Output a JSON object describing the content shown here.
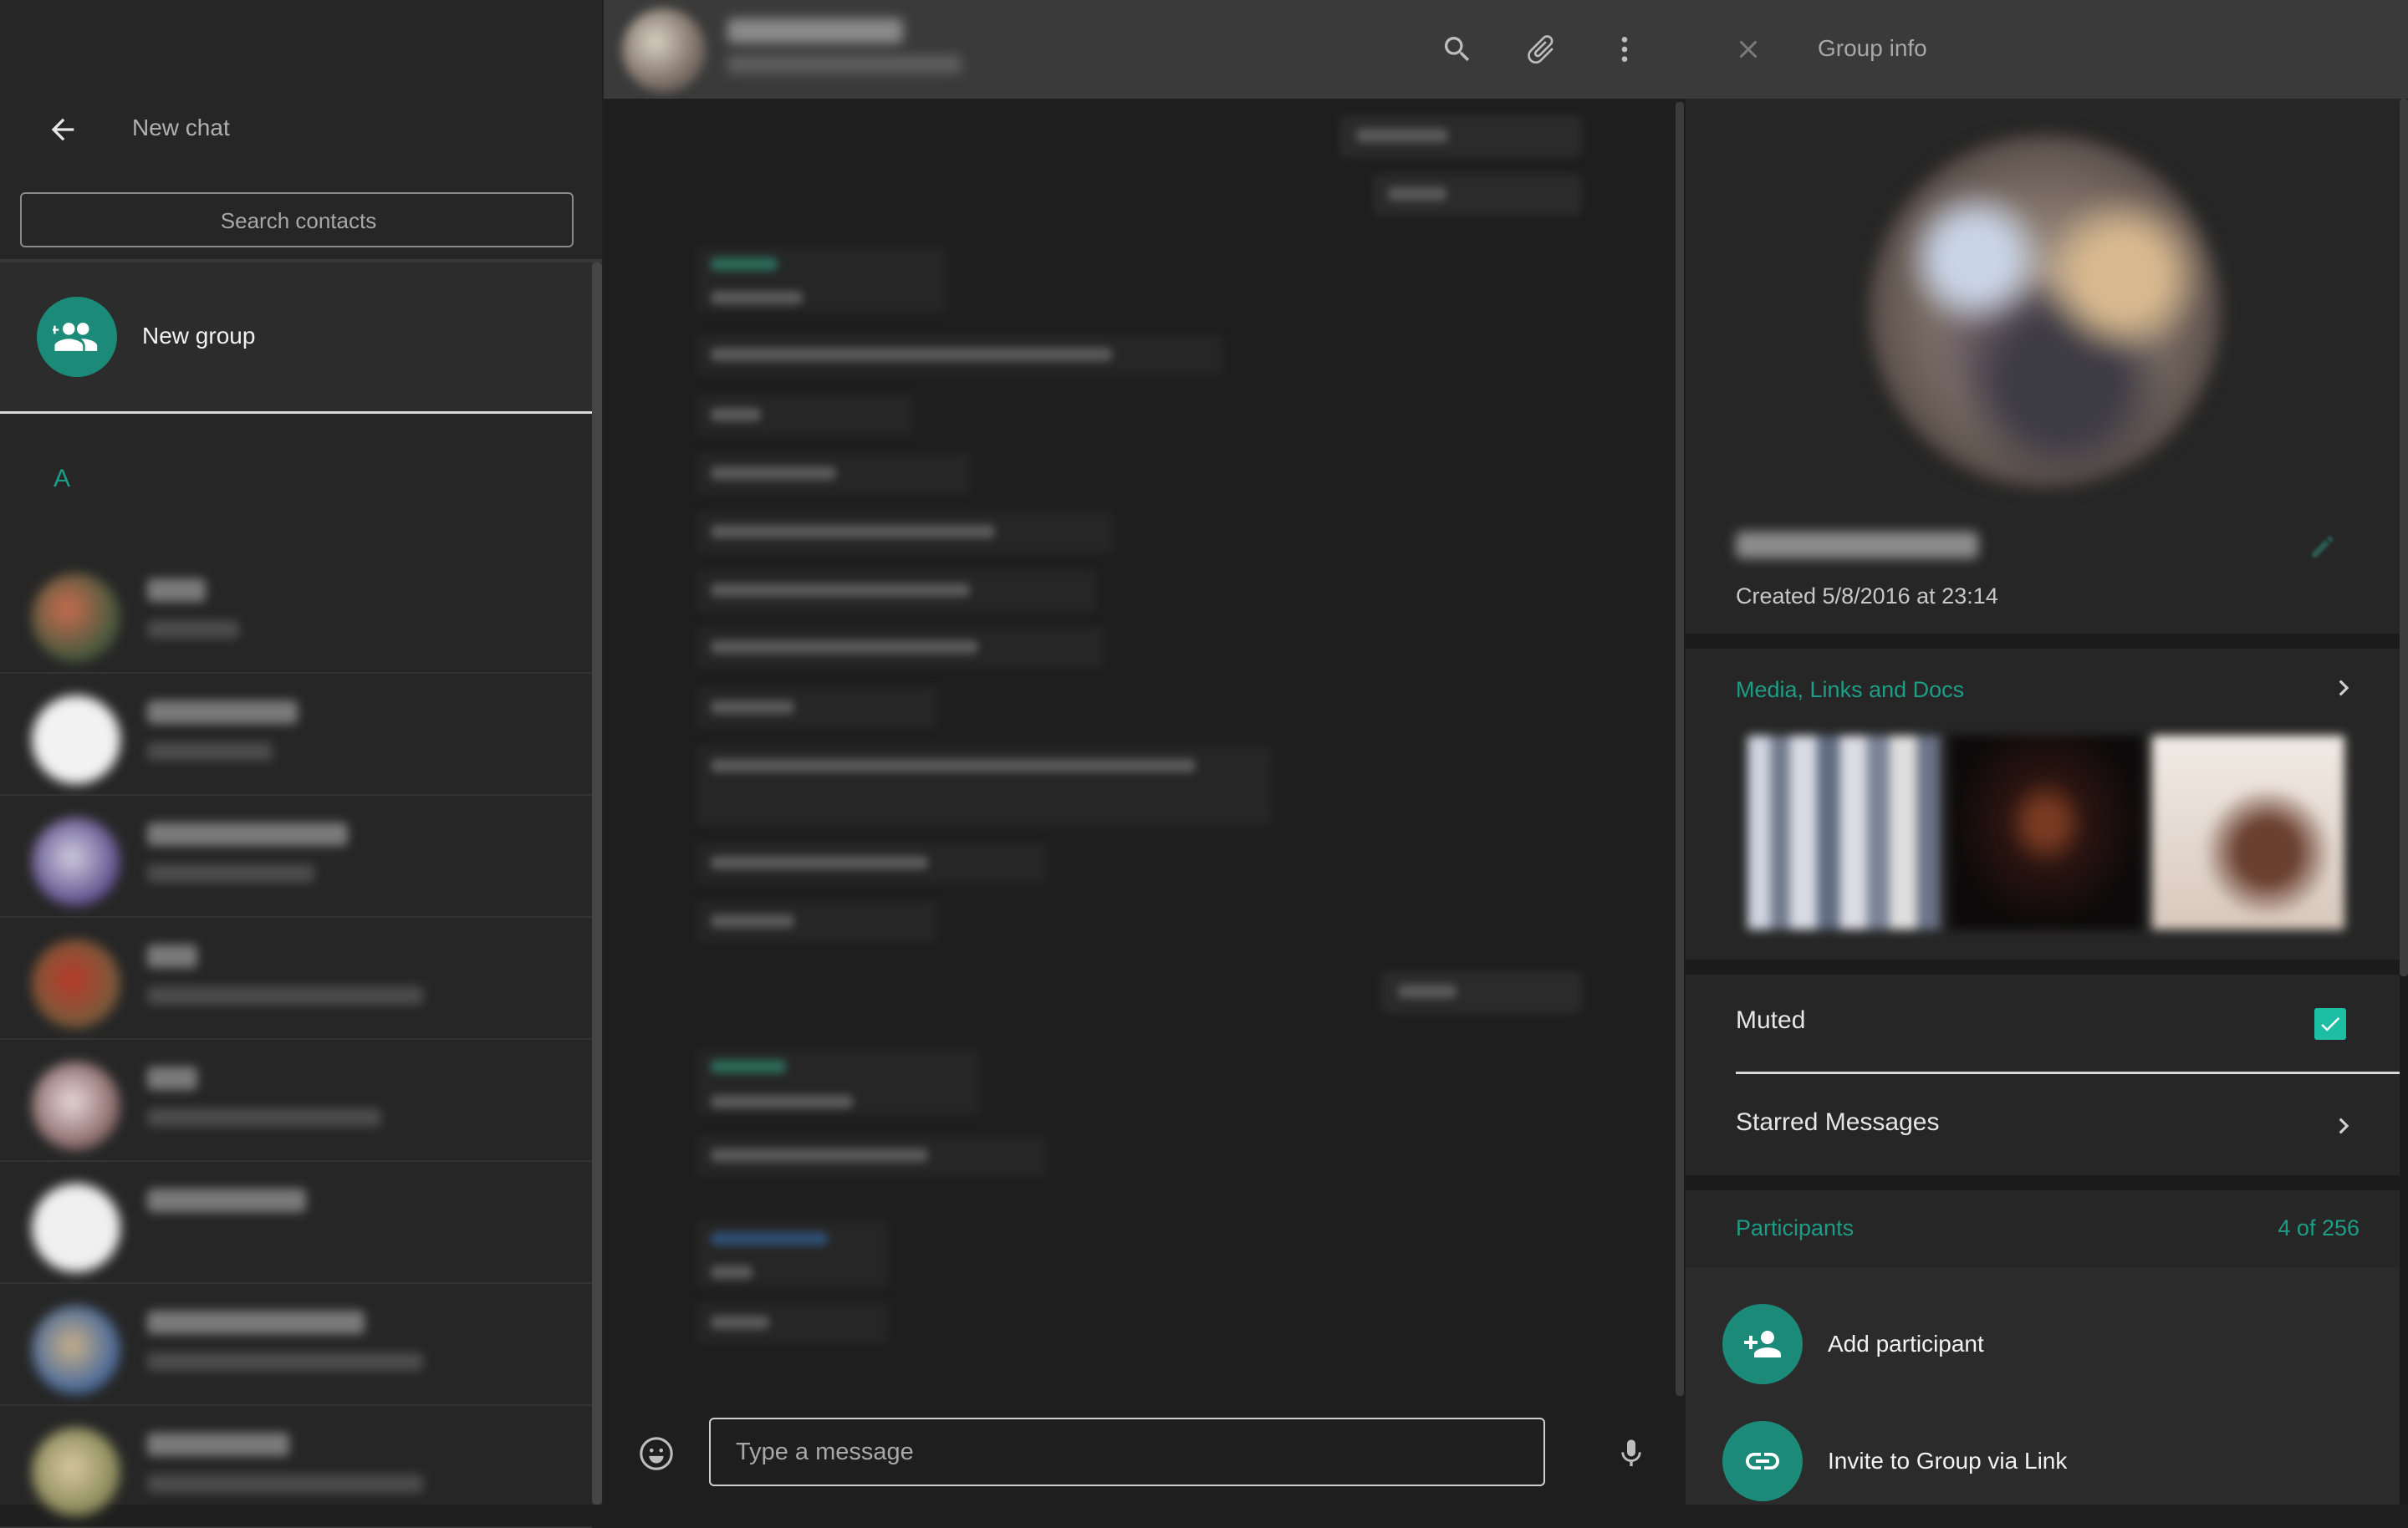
{
  "left_panel": {
    "title": "New chat",
    "search": {
      "placeholder": "Search contacts",
      "value": ""
    },
    "new_group_label": "New group",
    "section_letter": "A",
    "contacts_count_visible": 8
  },
  "chat": {
    "header_icons": [
      "search-icon",
      "attach-icon",
      "more-options-icon"
    ],
    "composer": {
      "placeholder": "Type a message",
      "value": ""
    },
    "composer_icons": [
      "emoji-icon",
      "microphone-icon"
    ]
  },
  "group_info": {
    "title": "Group info",
    "created_text": "Created 5/8/2016 at 23:14",
    "media_title": "Media, Links and Docs",
    "muted_label": "Muted",
    "muted_checked": true,
    "starred_label": "Starred Messages",
    "participants_label": "Participants",
    "participants_count": "4 of 256",
    "add_participant_label": "Add participant",
    "invite_label": "Invite to Group via Link"
  },
  "colors": {
    "accent": "#1e9d86",
    "accent_bg": "#1c8a78",
    "checkbox": "#1ebea5",
    "header_bg": "#3a3a3a",
    "panel_bg": "#262626"
  }
}
